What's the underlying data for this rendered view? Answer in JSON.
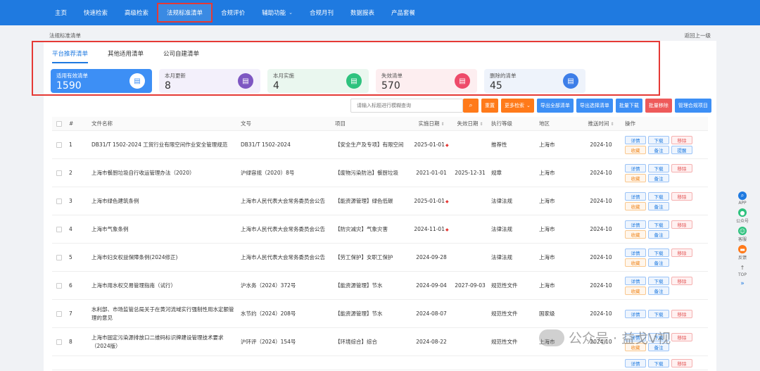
{
  "nav": {
    "items": [
      "主页",
      "快速检索",
      "高级检索",
      "法规标准清单",
      "合规评价",
      "辅助功能",
      "合规月刊",
      "数据报表",
      "产品套餐"
    ],
    "active_index": 3,
    "dropdown_index": 5
  },
  "breadcrumb": {
    "text": "法规标准清单",
    "back": "返回上一级"
  },
  "tabs": [
    "平台推荐清单",
    "其他适用清单",
    "公司自建清单"
  ],
  "stats": [
    {
      "label": "适用有效清单",
      "value": "1590",
      "icon": "doc-list-icon"
    },
    {
      "label": "本月更新",
      "value": "8",
      "icon": "doc-edit-icon"
    },
    {
      "label": "本月实施",
      "value": "4",
      "icon": "doc-icon"
    },
    {
      "label": "失效清单",
      "value": "570",
      "icon": "doc-invalid-icon"
    },
    {
      "label": "删除的清单",
      "value": "45",
      "icon": "doc-delete-icon"
    }
  ],
  "toolbar": {
    "search_placeholder": "请输入标题进行模糊查询",
    "reset": "重置",
    "more": "更多检索",
    "export_all": "导出全部清单",
    "export_selected": "导出选择清单",
    "batch_download": "批量下载",
    "batch_remove": "批量移除",
    "manage": "管理合规项目"
  },
  "table": {
    "headers": [
      "#",
      "文件名称",
      "文号",
      "项目",
      "实施日期",
      "失效日期",
      "执行等级",
      "地区",
      "推送时间",
      "操作"
    ],
    "rows": [
      {
        "idx": "1",
        "name": "DB31/T 1502-2024 工贸行业有限空间作业安全管理规范",
        "no": "DB31/T 1502-2024",
        "proj": "【安全生产及专项】有限空间",
        "start": "2025-01-01",
        "pin": true,
        "end": "",
        "level": "推荐性",
        "region": "上海市",
        "push": "2024-10",
        "ops": [
          "详情",
          "下载",
          "移除",
          "收藏",
          "备注",
          "提醒"
        ]
      },
      {
        "idx": "2",
        "name": "上海市餐厨垃圾自行收运管理办法（2020）",
        "no": "沪绿容规（2020）8号",
        "proj": "【废物污染防治】餐厨垃圾",
        "start": "2021-01-01",
        "pin": false,
        "end": "2025-12-31",
        "level": "规章",
        "region": "上海市",
        "push": "2024-10",
        "ops": [
          "详情",
          "下载",
          "移除",
          "收藏",
          "备注"
        ]
      },
      {
        "idx": "3",
        "name": "上海市绿色建筑条例",
        "no": "上海市人民代表大会常务委员会公告",
        "proj": "【能资源管理】绿色低碳",
        "start": "2025-01-01",
        "pin": true,
        "end": "",
        "level": "法律法规",
        "region": "上海市",
        "push": "2024-10",
        "ops": [
          "详情",
          "下载",
          "移除",
          "收藏",
          "备注"
        ]
      },
      {
        "idx": "4",
        "name": "上海市气象条例",
        "no": "上海市人民代表大会常务委员会公告",
        "proj": "【防灾减灾】气象灾害",
        "start": "2024-11-01",
        "pin": true,
        "end": "",
        "level": "法律法规",
        "region": "上海市",
        "push": "2024-10",
        "ops": [
          "详情",
          "下载",
          "移除",
          "收藏",
          "备注"
        ]
      },
      {
        "idx": "5",
        "name": "上海市妇女权益保障条例(2024修正)",
        "no": "上海市人民代表大会常务委员会公告",
        "proj": "【劳工保护】女职工保护",
        "start": "2024-09-28",
        "pin": false,
        "end": "",
        "level": "法律法规",
        "region": "上海市",
        "push": "2024-10",
        "ops": [
          "详情",
          "下载",
          "移除",
          "收藏",
          "备注"
        ]
      },
      {
        "idx": "6",
        "name": "上海市用水权交易管理指南（试行）",
        "no": "沪水务（2024）372号",
        "proj": "【能资源管理】节水",
        "start": "2024-09-04",
        "pin": false,
        "end": "2027-09-03",
        "level": "规范性文件",
        "region": "上海市",
        "push": "2024-10",
        "ops": [
          "详情",
          "下载",
          "移除",
          "收藏",
          "备注"
        ]
      },
      {
        "idx": "7",
        "name": "水利部、市场监管总局关于在黄河流域实行强制性用水定额管理的意见",
        "no": "水节约（2024）208号",
        "proj": "【能资源管理】节水",
        "start": "2024-08-07",
        "pin": false,
        "end": "",
        "level": "规范性文件",
        "region": "国家级",
        "push": "2024-10",
        "ops": [
          "详情",
          "下载",
          "移除"
        ]
      },
      {
        "idx": "8",
        "name": "上海市固定污染源排放口二维码标识牌建设管理技术要求（2024版）",
        "no": "沪环评（2024）154号",
        "proj": "【环境综合】综合",
        "start": "2024-08-22",
        "pin": false,
        "end": "",
        "level": "规范性文件",
        "region": "上海市",
        "push": "2024-10",
        "ops": [
          "详情",
          "下载",
          "移除",
          "收藏",
          "备注"
        ]
      },
      {
        "idx": "",
        "name": "",
        "no": "",
        "proj": "",
        "start": "",
        "pin": false,
        "end": "",
        "level": "",
        "region": "",
        "push": "",
        "ops": [
          "详情",
          "下载",
          "移除"
        ]
      }
    ]
  },
  "side_tools": [
    "APP",
    "公众号",
    "客服",
    "反馈",
    "TOP"
  ],
  "watermark": "公众号 · 益戈V视"
}
